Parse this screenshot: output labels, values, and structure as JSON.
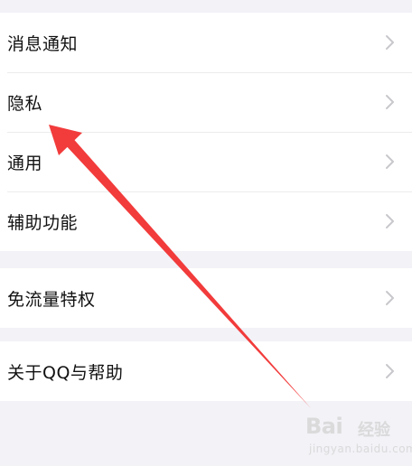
{
  "groups": [
    {
      "items": [
        {
          "label": "消息通知"
        },
        {
          "label": "隐私"
        },
        {
          "label": "通用"
        },
        {
          "label": "辅助功能"
        }
      ]
    },
    {
      "items": [
        {
          "label": "免流量特权"
        }
      ]
    },
    {
      "items": [
        {
          "label": "关于QQ与帮助"
        }
      ]
    }
  ],
  "icons": {
    "row_chevron": "chevron-right-icon"
  },
  "colors": {
    "background": "#f2f2f7",
    "row_background": "#ffffff",
    "text": "#111111",
    "chevron": "#c7c7cc",
    "annotation_arrow": "#f23b3b"
  },
  "watermark": {
    "brand": "Bai",
    "brand_cn": "经验",
    "sub": "jingyan.baidu.com"
  }
}
